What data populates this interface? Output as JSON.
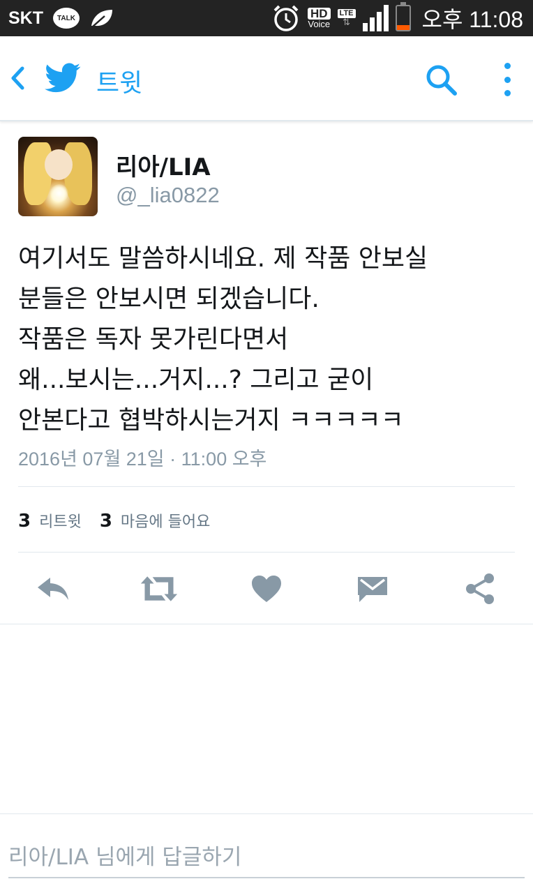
{
  "status_bar": {
    "carrier": "SKT",
    "talk_label": "TALK",
    "hd_label": "HD",
    "voice_label": "Voice",
    "lte_label": "LTE",
    "time": "오후 11:08",
    "battery_level": 0.2,
    "battery_color": "#ff5a00"
  },
  "toolbar": {
    "title": "트윗",
    "icons": [
      "chevron-left-icon",
      "twitter-bird-icon",
      "search-icon",
      "more-vertical-icon"
    ],
    "accent": "#1da1f2"
  },
  "tweet": {
    "display_name": "리아/LIA",
    "handle": "@_lia0822",
    "text_lines": [
      "여기서도 말씀하시네요. 제 작품 안보실",
      "분들은 안보시면 되겠습니다.",
      "작품은 독자 못가린다면서",
      "왜...보시는...거지...? 그리고 굳이",
      "안본다고 협박하시는거지 ㅋㅋㅋㅋㅋ"
    ],
    "timestamp": "2016년 07월 21일 · 11:00 오후",
    "retweet_count": "3",
    "retweet_label": "리트윗",
    "like_count": "3",
    "like_label": "마음에 들어요"
  },
  "actions": [
    "reply-icon",
    "retweet-icon",
    "heart-icon",
    "message-icon",
    "share-icon"
  ],
  "reply_bar": {
    "placeholder": "리아/LIA 님에게 답글하기"
  },
  "colors": {
    "text": "#14171a",
    "secondary": "#8899a6",
    "action_icon": "#8899a6",
    "divider": "#e1e8ed"
  }
}
